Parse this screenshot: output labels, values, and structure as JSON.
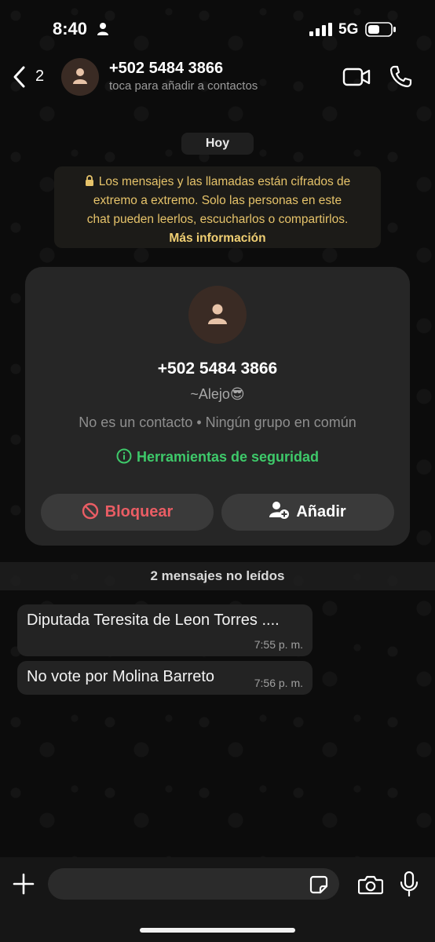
{
  "status_bar": {
    "time": "8:40",
    "network": "5G"
  },
  "header": {
    "back_count": "2",
    "contact_name": "+502 5484 3866",
    "subtitle": "toca para añadir a contactos"
  },
  "chat": {
    "date_label": "Hoy",
    "encryption_notice": {
      "lines": [
        "Los mensajes y las llamadas están cifrados de",
        "extremo a extremo. Solo las personas en este",
        "chat pueden leerlos, escucharlos o compartirlos."
      ],
      "link": "Más información"
    },
    "contact_card": {
      "phone": "+502 5484 3866",
      "alias": "~Alejo😎",
      "meta": "No es un contacto • Ningún grupo en común",
      "safety_link": "Herramientas de seguridad",
      "block_label": "Bloquear",
      "add_label": "Añadir"
    },
    "unread_label": "2 mensajes no leídos",
    "messages": [
      {
        "text": "Diputada Teresita de Leon Torres ....",
        "time": "7:55 p. m."
      },
      {
        "text": "No vote por Molina Barreto",
        "time": "7:56 p. m."
      }
    ]
  },
  "composer": {
    "value": "",
    "placeholder": ""
  },
  "icons": {
    "status": [
      "person-icon",
      "signal-icon",
      "battery-icon"
    ],
    "header": [
      "back-chevron-icon",
      "avatar-icon",
      "video-call-icon",
      "phone-call-icon"
    ],
    "composer": [
      "plus-icon",
      "sticker-icon",
      "camera-icon",
      "microphone-icon"
    ]
  },
  "colors": {
    "background": "#0b0b0b",
    "bubble": "#232323",
    "card": "#262626",
    "notice_text": "#e6c36a",
    "safety_green": "#3ec96a",
    "block_red": "#ea5d64",
    "avatar_bg": "#3a2b24",
    "avatar_fg": "#e7c3a8"
  }
}
